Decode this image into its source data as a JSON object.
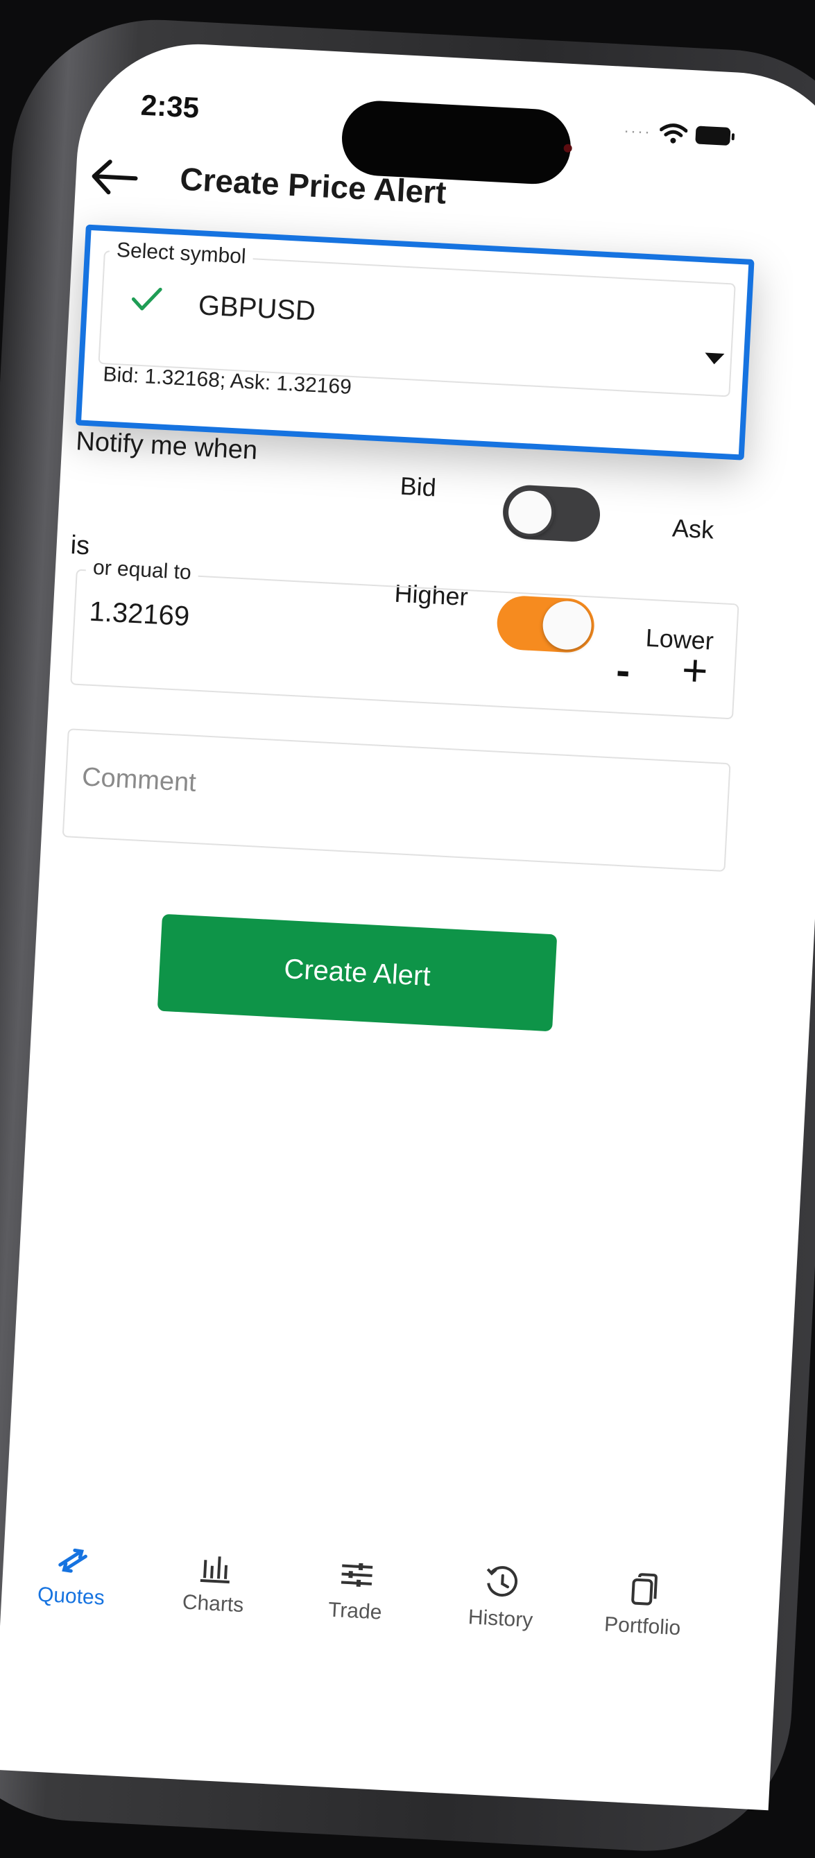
{
  "status_bar": {
    "time": "2:35",
    "signal_dots": "····"
  },
  "header": {
    "title": "Create Price Alert"
  },
  "symbol": {
    "legend": "Select symbol",
    "value": "GBPUSD",
    "quote": "Bid: 1.32168; Ask: 1.32169"
  },
  "notify": {
    "label": "Notify me when",
    "price_side": {
      "left": "Bid",
      "right": "Ask",
      "selected": "Ask"
    },
    "is_label": "is",
    "direction": {
      "left": "Higher",
      "right": "Lower",
      "selected": "Lower"
    }
  },
  "price": {
    "legend": "or equal to",
    "value": "1.32169",
    "minus": "-",
    "plus": "+"
  },
  "comment": {
    "placeholder": "Comment"
  },
  "create_button": "Create Alert",
  "colors": {
    "accent": "#1673e0",
    "toggle_on": "#f68b1f",
    "button": "#0e9448"
  },
  "tabs": [
    {
      "label": "Quotes",
      "icon": "quotes-icon",
      "active": true
    },
    {
      "label": "Charts",
      "icon": "charts-icon",
      "active": false
    },
    {
      "label": "Trade",
      "icon": "trade-icon",
      "active": false
    },
    {
      "label": "History",
      "icon": "history-icon",
      "active": false
    },
    {
      "label": "Portfolio",
      "icon": "portfolio-icon",
      "active": false
    }
  ]
}
